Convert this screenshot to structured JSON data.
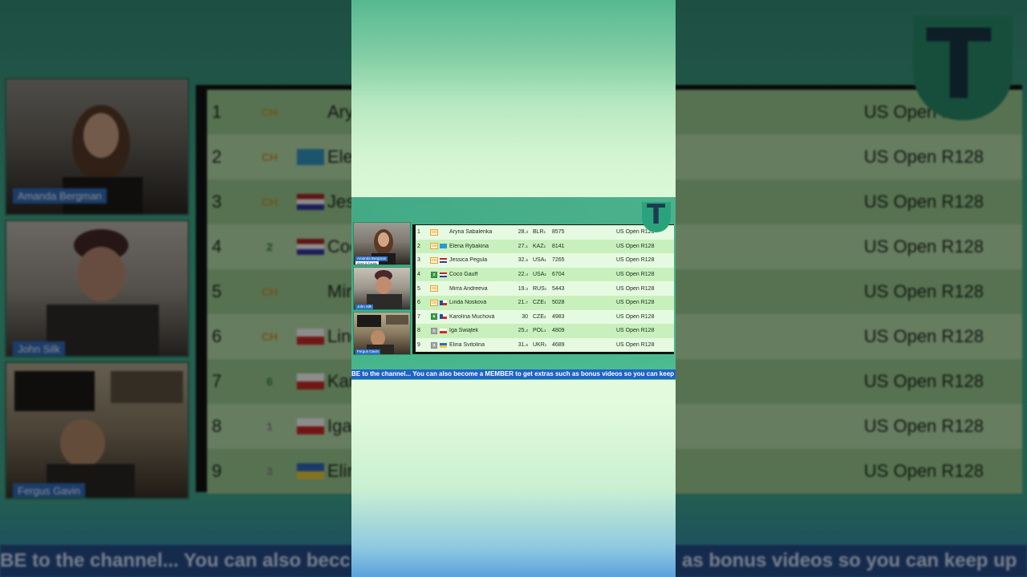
{
  "participants": [
    {
      "name": "Amanda Bergman",
      "subtitle": "Aces & Faults"
    },
    {
      "name": "John Silk"
    },
    {
      "name": "Fergus Gavin"
    }
  ],
  "standings": {
    "rows": [
      {
        "rank": "1",
        "seed": "CH",
        "seed_style": "ch",
        "flag": "none",
        "name": "Aryna Sabalenka",
        "age": "28.",
        "age_sub": "3",
        "country": "BLR",
        "country_sub": "1",
        "points": "8575",
        "tournament": "US Open R128",
        "bg_points_tail": "75"
      },
      {
        "rank": "2",
        "seed": "CH",
        "seed_style": "ch",
        "flag": "kaz",
        "name": "Elena Rybakina",
        "age": "27.",
        "age_sub": "1",
        "country": "KAZ",
        "country_sub": "1",
        "points": "8141",
        "tournament": "US Open R128",
        "bg_points_tail": "41"
      },
      {
        "rank": "3",
        "seed": "CH",
        "seed_style": "ch",
        "flag": "usa",
        "name": "Jessica Pegula",
        "age": "32.",
        "age_sub": "5",
        "country": "USA",
        "country_sub": "1",
        "points": "7265",
        "tournament": "US Open R128",
        "bg_points_tail": "65"
      },
      {
        "rank": "4",
        "seed": "2",
        "seed_style": "num",
        "flag": "usa",
        "name": "Coco Gauff",
        "age": "22.",
        "age_sub": "4",
        "country": "USA",
        "country_sub": "2",
        "points": "6704",
        "tournament": "US Open R128",
        "bg_points_tail": "04"
      },
      {
        "rank": "5",
        "seed": "CH",
        "seed_style": "ch",
        "flag": "none",
        "name": "Mirra Andreeva",
        "age": "19.",
        "age_sub": "3",
        "country": "RUS",
        "country_sub": "1",
        "points": "5443",
        "tournament": "US Open R128",
        "bg_points_tail": "43"
      },
      {
        "rank": "6",
        "seed": "CH",
        "seed_style": "ch",
        "flag": "cze",
        "name": "Linda Nosková",
        "age": "21.",
        "age_sub": "7",
        "country": "CZE",
        "country_sub": "1",
        "points": "5028",
        "tournament": "US Open R128",
        "bg_points_tail": ""
      },
      {
        "rank": "7",
        "seed": "6",
        "seed_style": "num",
        "flag": "cze",
        "name": "Karolína Muchová",
        "age": "30",
        "age_sub": "",
        "country": "CZE",
        "country_sub": "2",
        "points": "4983",
        "tournament": "US Open R128",
        "bg_points_tail": "83"
      },
      {
        "rank": "8",
        "seed": "1",
        "seed_style": "grey",
        "flag": "pol",
        "name": "Iga Świątek",
        "age": "25.",
        "age_sub": "2",
        "country": "POL",
        "country_sub": "1",
        "points": "4809",
        "tournament": "US Open R128",
        "bg_points_tail": "09"
      },
      {
        "rank": "9",
        "seed": "3",
        "seed_style": "grey",
        "flag": "ukr",
        "name": "Elina Svitolina",
        "age": "31.",
        "age_sub": "5",
        "country": "UKR",
        "country_sub": "1",
        "points": "4689",
        "tournament": "US Open R128",
        "bg_points_tail": "89"
      }
    ]
  },
  "bg_name_fragments": [
    "Aryn",
    "Elen",
    "Jess",
    "Coc",
    "Mir",
    "Linc",
    "Kar",
    "Iga",
    "Elin"
  ],
  "ticker": {
    "text": "BE to the channel... You can also become a MEMBER to get extras such as bonus videos so you can keep up",
    "bg_left": "BE to the channel... You can also becc",
    "bg_right": "as bonus videos so you can keep up"
  },
  "logo": {
    "letter": "T",
    "color": "#2aa37c"
  },
  "colors": {
    "ticker": "#1f63c8",
    "row_light": "#e6fae1",
    "row_dark": "#c8f0bd",
    "seed_ch": "#e6a22a",
    "seed_num": "#3c9b46",
    "name_tag": "#2b6fc9"
  },
  "icons": [
    "flag-kazakhstan-icon",
    "flag-usa-icon",
    "flag-czech-icon",
    "flag-poland-icon",
    "flag-ukraine-icon",
    "channel-logo-t-icon"
  ]
}
